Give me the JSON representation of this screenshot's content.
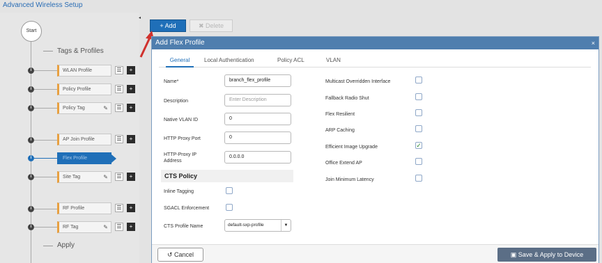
{
  "page": {
    "title": "Advanced Wireless Setup"
  },
  "toolbar": {
    "add_label": "+ Add",
    "delete_label": "✖ Delete"
  },
  "workflow": {
    "start_label": "Start",
    "sections": [
      {
        "label": "Tags & Profiles"
      },
      {
        "label": "Apply"
      }
    ],
    "steps": [
      {
        "label": "WLAN Profile"
      },
      {
        "label": "Policy Profile"
      },
      {
        "label": "Policy Tag"
      },
      {
        "label": "AP Join Profile"
      },
      {
        "label": "Flex Profile"
      },
      {
        "label": "Site Tag"
      },
      {
        "label": "RF Profile"
      },
      {
        "label": "RF Tag"
      }
    ],
    "active_step": "Flex Profile"
  },
  "modal": {
    "title": "Add Flex Profile",
    "close_icon": "×",
    "tabs": [
      "General",
      "Local Authentication",
      "Policy ACL",
      "VLAN"
    ],
    "active_tab": "General",
    "fields": {
      "name": {
        "label": "Name*",
        "value": "branch_flex_profile"
      },
      "description": {
        "label": "Description",
        "placeholder": "Enter Description"
      },
      "native_vlan": {
        "label": "Native VLAN ID",
        "value": "0"
      },
      "http_proxy_port": {
        "label": "HTTP Proxy Port",
        "value": "0"
      },
      "http_proxy_ip": {
        "label": "HTTP-Proxy IP Address",
        "value": "0.0.0.0"
      }
    },
    "cts": {
      "header": "CTS Policy",
      "inline_tagging": {
        "label": "Inline Tagging",
        "checked": false
      },
      "sgacl_enforcement": {
        "label": "SGACL Enforcement",
        "checked": false
      },
      "profile_name": {
        "label": "CTS Profile Name",
        "value": "default-sxp-profile"
      }
    },
    "options": [
      {
        "label": "Multicast Overridden Interface",
        "checked": false
      },
      {
        "label": "Fallback Radio Shut",
        "checked": false
      },
      {
        "label": "Flex Resilient",
        "checked": false
      },
      {
        "label": "ARP Caching",
        "checked": false
      },
      {
        "label": "Efficient Image Upgrade",
        "checked": true
      },
      {
        "label": "Office Extend AP",
        "checked": false
      },
      {
        "label": "Join Minimum Latency",
        "checked": false
      }
    ],
    "footer": {
      "cancel_label": "Cancel",
      "save_label": "Save & Apply to Device"
    }
  },
  "colors": {
    "accent": "#1f6fb8",
    "modal_header": "#4f7eae",
    "save_button": "#5b6e86",
    "arrow": "#d0312d",
    "step_marker": "#e8a040"
  }
}
